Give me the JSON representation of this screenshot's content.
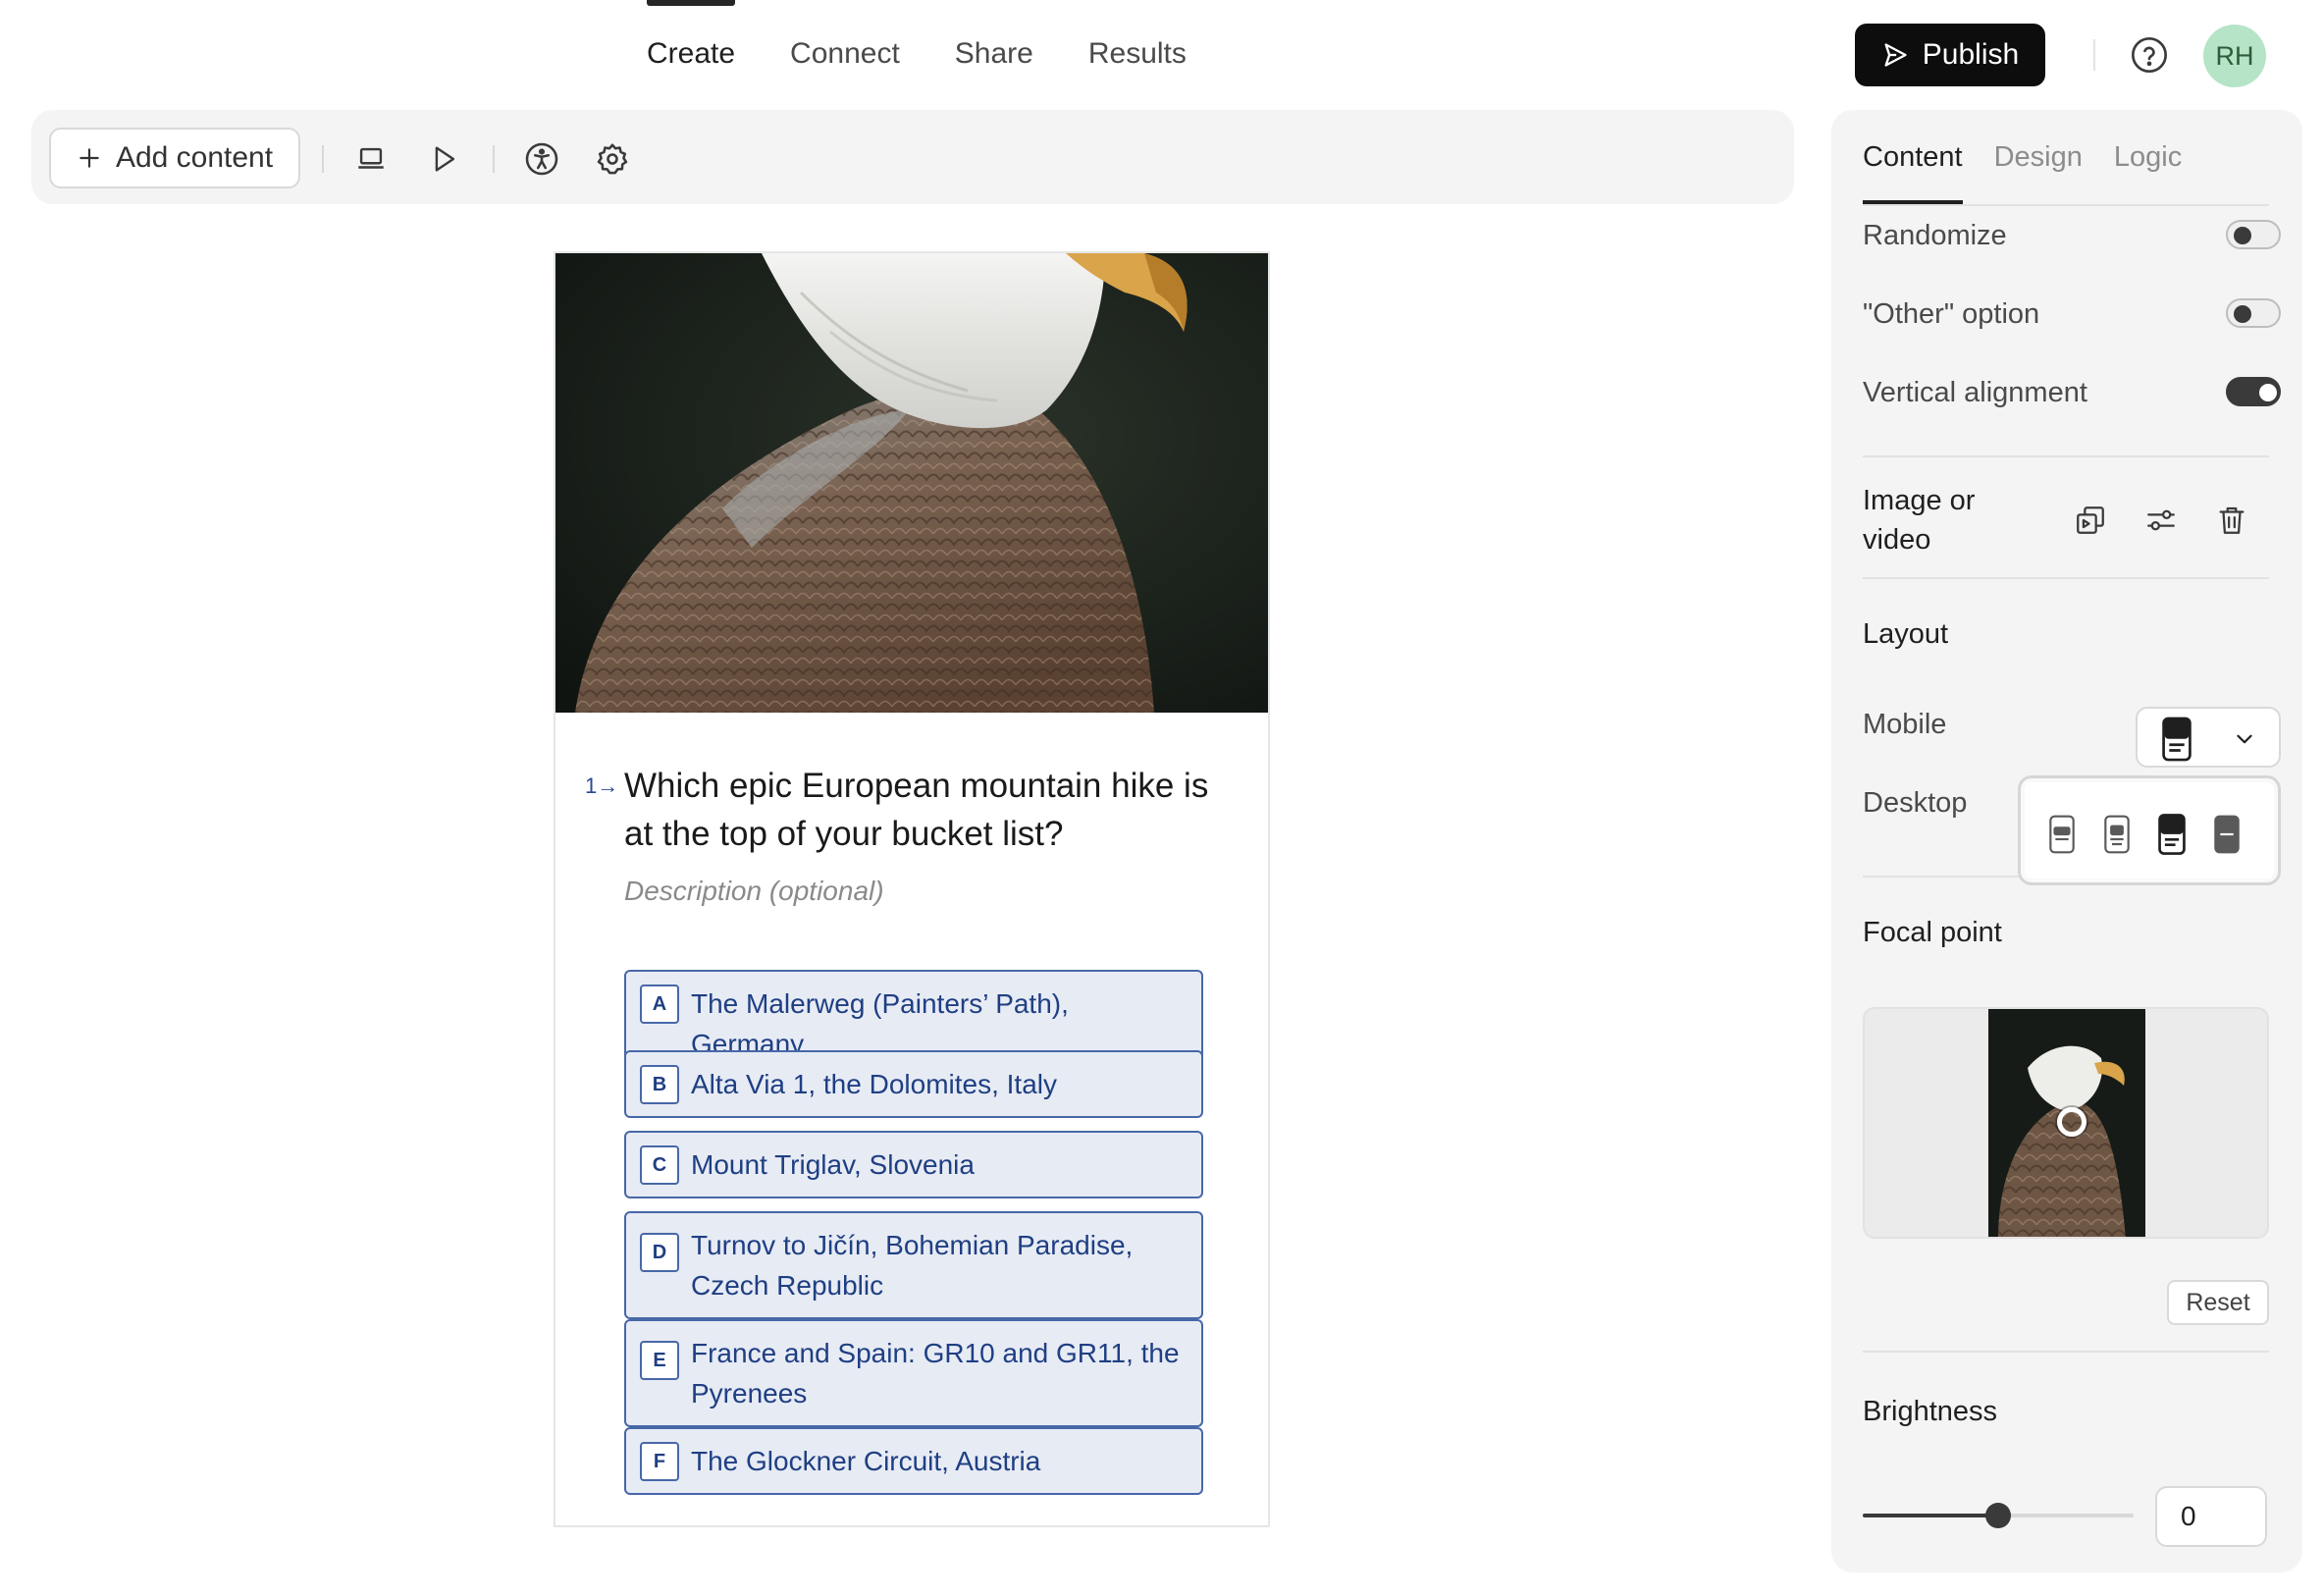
{
  "nav": {
    "tabs": [
      {
        "label": "Create",
        "active": true
      },
      {
        "label": "Connect",
        "active": false
      },
      {
        "label": "Share",
        "active": false
      },
      {
        "label": "Results",
        "active": false
      }
    ],
    "publish_label": "Publish",
    "help_icon": "question-circle-icon",
    "avatar_initials": "RH",
    "avatar_color": "#b5e4c6"
  },
  "toolbar": {
    "add_content_label": "Add content",
    "icons": [
      "laptop-icon",
      "play-icon",
      "accessibility-icon",
      "settings-icon"
    ]
  },
  "question": {
    "number": "1",
    "title": "Which epic European mountain hike is at the top of your bucket list?",
    "description_placeholder": "Description (optional)",
    "choices": [
      {
        "key": "A",
        "label": "The Malerweg (Painters’ Path), Germany"
      },
      {
        "key": "B",
        "label": "Alta Via 1, the Dolomites, Italy"
      },
      {
        "key": "C",
        "label": "Mount Triglav, Slovenia"
      },
      {
        "key": "D",
        "label": "Turnov to Jičín, Bohemian Paradise, Czech Republic"
      },
      {
        "key": "E",
        "label": "France and Spain: GR10 and GR11, the Pyrenees"
      },
      {
        "key": "F",
        "label": "The Glockner Circuit, Austria"
      }
    ],
    "accent_color": "#1f3f83"
  },
  "panel": {
    "tabs": [
      {
        "label": "Content",
        "active": true
      },
      {
        "label": "Design",
        "active": false
      },
      {
        "label": "Logic",
        "active": false
      }
    ],
    "settings": {
      "randomize": {
        "label": "Randomize",
        "on": false
      },
      "other_option": {
        "label": "\"Other\" option",
        "on": false
      },
      "vertical_alignment": {
        "label": "Vertical alignment",
        "on": true
      }
    },
    "image_or_video_label": "Image or video",
    "layout": {
      "title": "Layout",
      "mobile_label": "Mobile",
      "desktop_label": "Desktop"
    },
    "focal_point": {
      "title": "Focal point",
      "reset_label": "Reset"
    },
    "brightness": {
      "title": "Brightness",
      "value": "0",
      "slider_fraction": 0.5
    }
  }
}
